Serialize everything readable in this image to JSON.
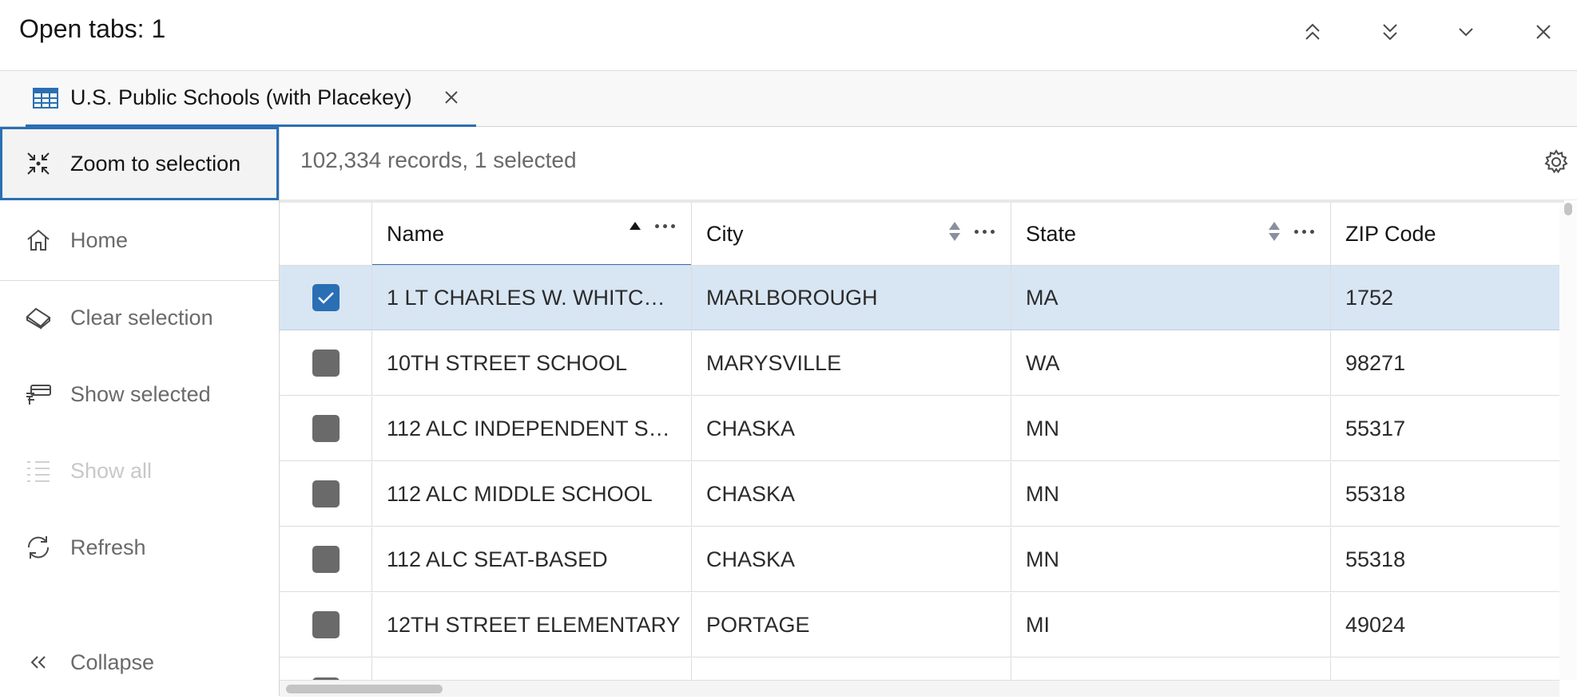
{
  "header": {
    "title": "Open tabs: 1"
  },
  "tab": {
    "label": "U.S. Public Schools (with Placekey)"
  },
  "sidebar": {
    "items": [
      {
        "label": "Zoom to selection",
        "icon": "zoom-to-selection-icon",
        "state": "active"
      },
      {
        "label": "Home",
        "icon": "home-icon",
        "state": "normal"
      },
      {
        "label": "Clear selection",
        "icon": "eraser-icon",
        "state": "normal"
      },
      {
        "label": "Show selected",
        "icon": "show-selected-icon",
        "state": "normal"
      },
      {
        "label": "Show all",
        "icon": "list-icon",
        "state": "disabled"
      },
      {
        "label": "Refresh",
        "icon": "refresh-icon",
        "state": "normal"
      },
      {
        "label": "Collapse",
        "icon": "double-chevron-left-icon",
        "state": "normal"
      }
    ]
  },
  "table": {
    "record_count": "102,334 records, 1 selected",
    "columns": [
      "Name",
      "City",
      "State",
      "ZIP Code"
    ],
    "sorted_column": "Name",
    "sort_direction": "ascending",
    "rows": [
      {
        "name": "1 LT CHARLES W. WHITC…",
        "city": "MARLBOROUGH",
        "state": "MA",
        "zip": "1752",
        "selected": true
      },
      {
        "name": "10TH STREET SCHOOL",
        "city": "MARYSVILLE",
        "state": "WA",
        "zip": "98271",
        "selected": false
      },
      {
        "name": "112 ALC INDEPENDENT S…",
        "city": "CHASKA",
        "state": "MN",
        "zip": "55317",
        "selected": false
      },
      {
        "name": "112 ALC MIDDLE SCHOOL",
        "city": "CHASKA",
        "state": "MN",
        "zip": "55318",
        "selected": false
      },
      {
        "name": "112 ALC SEAT-BASED",
        "city": "CHASKA",
        "state": "MN",
        "zip": "55318",
        "selected": false
      },
      {
        "name": "12TH STREET ELEMENTARY",
        "city": "PORTAGE",
        "state": "MI",
        "zip": "49024",
        "selected": false
      }
    ]
  },
  "colors": {
    "accent": "#2a6fb3",
    "selected_row": "#d8e5f3",
    "checkbox_unchecked": "#6a6a6a"
  }
}
